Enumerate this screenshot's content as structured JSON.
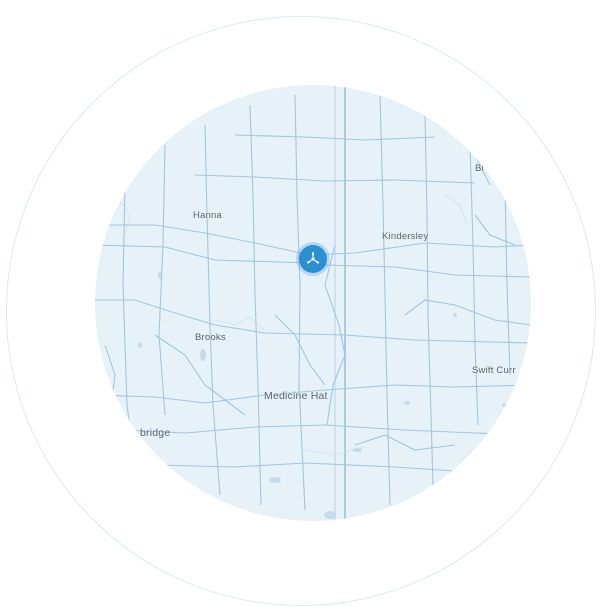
{
  "map": {
    "labels": {
      "hanna": "Hanna",
      "kindersley": "Kindersley",
      "brooks": "Brooks",
      "medicine_hat": "Medicine Hat",
      "swift_current": "Swift Curr",
      "lethbridge": "bridge",
      "biggar": "Bi"
    },
    "marker_icon": "wind-turbine-icon",
    "colors": {
      "map_background": "#e6f1f8",
      "roads": "#9fc7e0",
      "marker": "#2b8fd1",
      "outer_ring": "#d6ebf7"
    }
  }
}
